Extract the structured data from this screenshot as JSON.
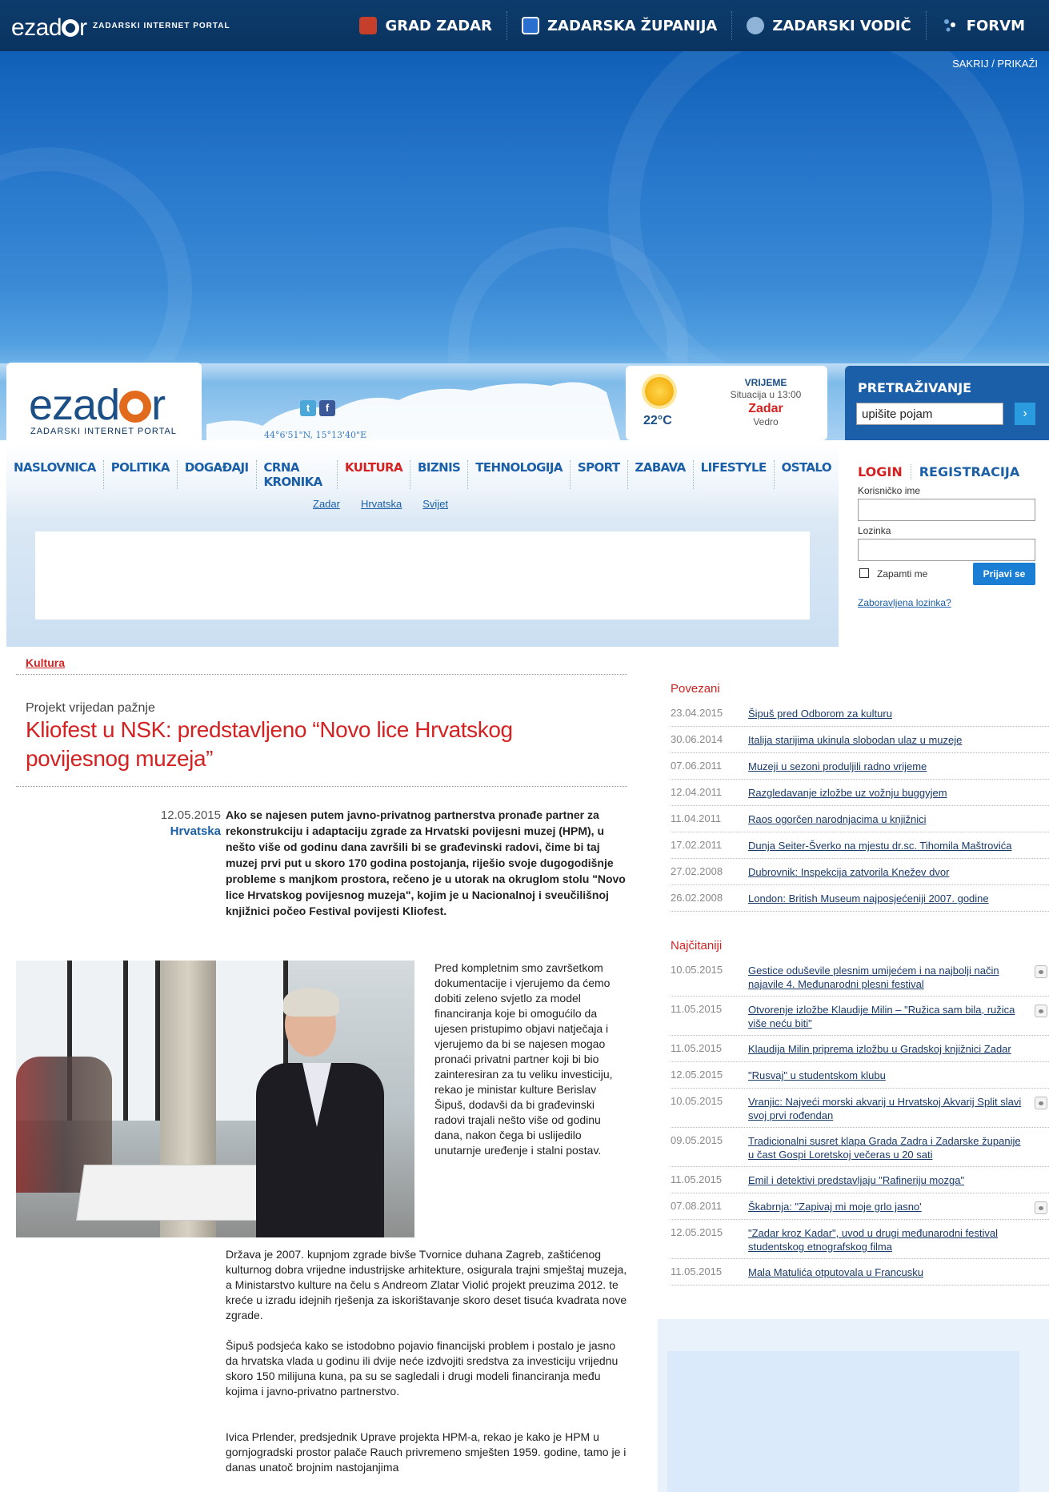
{
  "topbar": {
    "logo_text": "ezad",
    "logo_end": "r",
    "tagline": "ZADARSKI INTERNET PORTAL",
    "nav": [
      {
        "label": "GRAD ZADAR",
        "icon": "city-crest-icon",
        "color": "#c53f2a"
      },
      {
        "label": "ZADARSKA ŽUPANIJA",
        "icon": "county-crest-icon",
        "color": "#2a6fd0"
      },
      {
        "label": "ZADARSKI VODIČ",
        "icon": "guide-badge-icon",
        "color": "#8fb3d6"
      },
      {
        "label": "FORVM",
        "icon": "forum-dots-icon",
        "color": "#6fa4d8"
      }
    ]
  },
  "banner": {
    "toggle_label": "SAKRIJ / PRIKAŽI"
  },
  "header": {
    "logo_big": "ezad",
    "logo_big_end": "r",
    "logo_sub": "ZADARSKI INTERNET PORTAL",
    "social": [
      {
        "label": "t",
        "icon": "twitter-icon",
        "color": "#4aa7d8"
      },
      {
        "label": "f",
        "icon": "facebook-icon",
        "color": "#3b5998"
      }
    ],
    "coords": "44°6'51\"N, 15°13'40\"E"
  },
  "weather": {
    "heading": "VRIJEME",
    "situation": "Situacija u 13:00",
    "city": "Zadar",
    "condition": "Vedro",
    "temperature": "22°C",
    "icon": "sun-icon"
  },
  "search": {
    "heading": "PRETRAŽIVANJE",
    "value": "upišite pojam",
    "button": "›"
  },
  "mainnav": {
    "items": [
      {
        "label": "NASLOVNICA",
        "active": false
      },
      {
        "label": "POLITIKA",
        "active": false
      },
      {
        "label": "DOGAĐAJI",
        "active": false
      },
      {
        "label": "CRNA KRONIKA",
        "active": false
      },
      {
        "label": "KULTURA",
        "active": true
      },
      {
        "label": "BIZNIS",
        "active": false
      },
      {
        "label": "TEHNOLOGIJA",
        "active": false
      },
      {
        "label": "SPORT",
        "active": false
      },
      {
        "label": "ZABAVA",
        "active": false
      },
      {
        "label": "LIFESTYLE",
        "active": false
      },
      {
        "label": "OSTALO",
        "active": false
      }
    ],
    "subitems": [
      "Zadar",
      "Hrvatska",
      "Svijet"
    ]
  },
  "login": {
    "tab_login": "LOGIN",
    "tab_register": "REGISTRACIJA",
    "username_label": "Korisničko ime",
    "password_label": "Lozinka",
    "remember_label": "Zapamti me",
    "submit_label": "Prijavi se",
    "forgot_label": "Zaboravljena lozinka?"
  },
  "article": {
    "section": "Kultura",
    "kicker": "Projekt vrijedan pažnje",
    "title": "Kliofest u NSK: predstavljeno “Novo lice Hrvatskog povijesnog muzeja”",
    "date": "12.05.2015",
    "category": "Hrvatska",
    "lead": "Ako se najesen putem javno-privatnog partnerstva pronađe partner za rekonstrukciju i adaptaciju zgrade za Hrvatski povijesni muzej (HPM), u nešto više od godinu dana završili bi se građevinski radovi, čime bi taj muzej prvi put u skoro 170 godina postojanja, riješio svoje dugogodišnje probleme s manjkom prostora, rečeno je u utorak na okruglom stolu \"Novo lice Hrvatskog povijesnog muzeja\", kojim je u Nacionalnoj i sveučilišnoj knjižnici počeo Festival povijesti Kliofest.",
    "side_text": "Pred kompletnim smo završetkom dokumentacije i vjerujemo da ćemo dobiti zeleno svjetlo za model financiranja koje bi omogućilo da ujesen pristupimo objavi natječaja i vjerujemo da bi se najesen mogao pronaći privatni partner koji bi bio zainteresiran za tu veliku investiciju, rekao je ministar kulture Berislav Šipuš, dodavši da bi građevinski radovi trajali nešto više od godinu dana, nakon čega bi uslijedilo unutarnje uređenje i stalni postav.",
    "paragraphs": [
      "Država je 2007. kupnjom zgrade bivše Tvornice duhana Zagreb, zaštićenog kulturnog dobra vrijedne industrijske arhitekture, osigurala trajni smještaj muzeja, a Ministarstvo kulture na čelu s Andreom Zlatar Violić projekt preuzima 2012. te kreće u izradu idejnih rješenja za iskorištavanje skoro deset tisuća kvadrata nove zgrade.",
      "Šipuš podsjeća kako se istodobno pojavio financijski problem i postalo je jasno da hrvatska vlada u godinu ili dvije neće izdvojiti sredstva za investiciju vrijednu skoro 150 milijuna kuna, pa su se sagledali i drugi modeli financiranja među kojima i javno-privatno partnerstvo.",
      "Ivica Prlender, predsjednik Uprave projekta HPM-a, rekao je kako je HPM u gornjogradski prostor palače Rauch privremeno smješten 1959. godine, tamo je i danas unatoč brojnim nastojanjima"
    ]
  },
  "related": {
    "title": "Povezani",
    "items": [
      {
        "date": "23.04.2015",
        "title": "Šipuš pred Odborom za kulturu"
      },
      {
        "date": "30.06.2014",
        "title": "Italija starijima ukinula slobodan ulaz u muzeje"
      },
      {
        "date": "07.06.2011",
        "title": "Muzeji u sezoni produljili radno vrijeme"
      },
      {
        "date": "12.04.2011",
        "title": "Razgledavanje izložbe uz vožnju buggyjem"
      },
      {
        "date": "11.04.2011",
        "title": "Raos ogorčen narodnjacima u knjižnici"
      },
      {
        "date": "17.02.2011",
        "title": "Dunja Seiter-Šverko na mjestu dr.sc. Tihomila Maštrovića"
      },
      {
        "date": "27.02.2008",
        "title": "Dubrovnik: Inspekcija zatvorila Knežev dvor"
      },
      {
        "date": "26.02.2008",
        "title": "London: British Museum najposjećeniji 2007. godine"
      }
    ]
  },
  "most_read": {
    "title": "Najčitaniji",
    "items": [
      {
        "date": "10.05.2015",
        "title": "Gestice oduševile plesnim umijećem i na najbolji način najavile 4. Međunarodni plesni festival",
        "photo": true
      },
      {
        "date": "11.05.2015",
        "title": "Otvorenje izložbe Klaudije Milin – \"Ružica sam bila, ružica više neću biti\"",
        "photo": true
      },
      {
        "date": "11.05.2015",
        "title": "Klaudija Milin priprema izložbu u Gradskoj knjižnici Zadar",
        "photo": false
      },
      {
        "date": "12.05.2015",
        "title": "\"Rusvaj\" u studentskom klubu",
        "photo": false
      },
      {
        "date": "10.05.2015",
        "title": "Vranjic: Najveći morski akvarij u Hrvatskoj Akvarij Split slavi svoj prvi rođendan",
        "photo": true
      },
      {
        "date": "09.05.2015",
        "title": "Tradicionalni susret klapa Grada Zadra i Zadarske županije u čast Gospi Loretskoj večeras u 20 sati",
        "photo": false
      },
      {
        "date": "11.05.2015",
        "title": "Emil i detektivi predstavljaju \"Rafineriju mozga\"",
        "photo": false
      },
      {
        "date": "07.08.2011",
        "title": "Škabrnja: \"Zapivaj mi moje grlo jasno'",
        "photo": true
      },
      {
        "date": "12.05.2015",
        "title": "\"Zadar kroz Kadar\", uvod u drugi međunarodni festival studentskog etnografskog filma",
        "photo": false
      },
      {
        "date": "11.05.2015",
        "title": "Mala Matulića otputovala u Francusku",
        "photo": false
      }
    ]
  }
}
